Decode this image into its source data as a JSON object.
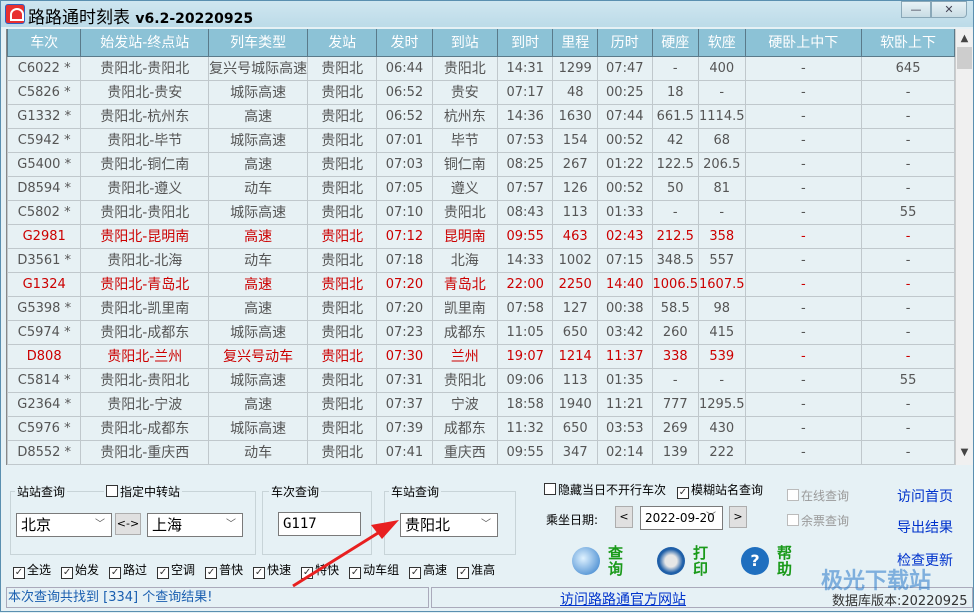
{
  "window": {
    "title": "路路通时刻表",
    "version": "v6.2-20220925",
    "minimize_glyph": "—",
    "close_glyph": "✕"
  },
  "table": {
    "columns": [
      "车次",
      "始发站-终点站",
      "列车类型",
      "发站",
      "发时",
      "到站",
      "到时",
      "里程",
      "历时",
      "硬座",
      "软座",
      "硬卧上中下",
      "软卧上下"
    ],
    "rows": [
      {
        "highlight": false,
        "cells": [
          "C6022 *",
          "贵阳北-贵阳北",
          "复兴号城际高速",
          "贵阳北",
          "06:44",
          "贵阳北",
          "14:31",
          "1299",
          "07:47",
          "-",
          "400",
          "-",
          "645"
        ]
      },
      {
        "highlight": false,
        "cells": [
          "C5826 *",
          "贵阳北-贵安",
          "城际高速",
          "贵阳北",
          "06:52",
          "贵安",
          "07:17",
          "48",
          "00:25",
          "18",
          "-",
          "-",
          "-"
        ]
      },
      {
        "highlight": false,
        "cells": [
          "G1332 *",
          "贵阳北-杭州东",
          "高速",
          "贵阳北",
          "06:52",
          "杭州东",
          "14:36",
          "1630",
          "07:44",
          "661.5",
          "1114.5",
          "-",
          "-"
        ]
      },
      {
        "highlight": false,
        "cells": [
          "C5942 *",
          "贵阳北-毕节",
          "城际高速",
          "贵阳北",
          "07:01",
          "毕节",
          "07:53",
          "154",
          "00:52",
          "42",
          "68",
          "-",
          "-"
        ]
      },
      {
        "highlight": false,
        "cells": [
          "G5400 *",
          "贵阳北-铜仁南",
          "高速",
          "贵阳北",
          "07:03",
          "铜仁南",
          "08:25",
          "267",
          "01:22",
          "122.5",
          "206.5",
          "-",
          "-"
        ]
      },
      {
        "highlight": false,
        "cells": [
          "D8594 *",
          "贵阳北-遵义",
          "动车",
          "贵阳北",
          "07:05",
          "遵义",
          "07:57",
          "126",
          "00:52",
          "50",
          "81",
          "-",
          "-"
        ]
      },
      {
        "highlight": false,
        "cells": [
          "C5802 *",
          "贵阳北-贵阳北",
          "城际高速",
          "贵阳北",
          "07:10",
          "贵阳北",
          "08:43",
          "113",
          "01:33",
          "-",
          "-",
          "-",
          "55"
        ]
      },
      {
        "highlight": true,
        "cells": [
          "G2981",
          "贵阳北-昆明南",
          "高速",
          "贵阳北",
          "07:12",
          "昆明南",
          "09:55",
          "463",
          "02:43",
          "212.5",
          "358",
          "-",
          "-"
        ]
      },
      {
        "highlight": false,
        "cells": [
          "D3561 *",
          "贵阳北-北海",
          "动车",
          "贵阳北",
          "07:18",
          "北海",
          "14:33",
          "1002",
          "07:15",
          "348.5",
          "557",
          "-",
          "-"
        ]
      },
      {
        "highlight": true,
        "cells": [
          "G1324",
          "贵阳北-青岛北",
          "高速",
          "贵阳北",
          "07:20",
          "青岛北",
          "22:00",
          "2250",
          "14:40",
          "1006.5",
          "1607.5",
          "-",
          "-"
        ]
      },
      {
        "highlight": false,
        "cells": [
          "G5398 *",
          "贵阳北-凯里南",
          "高速",
          "贵阳北",
          "07:20",
          "凯里南",
          "07:58",
          "127",
          "00:38",
          "58.5",
          "98",
          "-",
          "-"
        ]
      },
      {
        "highlight": false,
        "cells": [
          "C5974 *",
          "贵阳北-成都东",
          "城际高速",
          "贵阳北",
          "07:23",
          "成都东",
          "11:05",
          "650",
          "03:42",
          "260",
          "415",
          "-",
          "-"
        ]
      },
      {
        "highlight": true,
        "cells": [
          "D808",
          "贵阳北-兰州",
          "复兴号动车",
          "贵阳北",
          "07:30",
          "兰州",
          "19:07",
          "1214",
          "11:37",
          "338",
          "539",
          "-",
          "-"
        ]
      },
      {
        "highlight": false,
        "cells": [
          "C5814 *",
          "贵阳北-贵阳北",
          "城际高速",
          "贵阳北",
          "07:31",
          "贵阳北",
          "09:06",
          "113",
          "01:35",
          "-",
          "-",
          "-",
          "55"
        ]
      },
      {
        "highlight": false,
        "cells": [
          "G2364 *",
          "贵阳北-宁波",
          "高速",
          "贵阳北",
          "07:37",
          "宁波",
          "18:58",
          "1940",
          "11:21",
          "777",
          "1295.5",
          "-",
          "-"
        ]
      },
      {
        "highlight": false,
        "cells": [
          "C5976 *",
          "贵阳北-成都东",
          "城际高速",
          "贵阳北",
          "07:39",
          "成都东",
          "11:32",
          "650",
          "03:53",
          "269",
          "430",
          "-",
          "-"
        ]
      },
      {
        "highlight": false,
        "cells": [
          "D8552 *",
          "贵阳北-重庆西",
          "动车",
          "贵阳北",
          "07:41",
          "重庆西",
          "09:55",
          "347",
          "02:14",
          "139",
          "222",
          "-",
          "-"
        ]
      }
    ],
    "highlight_color": "#cc0000"
  },
  "station_query": {
    "label": "站站查询",
    "transfer_label": "指定中转站",
    "transfer_checked": false,
    "from": "北京",
    "to": "上海",
    "swap_label": "<->"
  },
  "train_query": {
    "label": "车次查询",
    "value": "G117"
  },
  "stop_query": {
    "label": "车站查询",
    "value": "贵阳北"
  },
  "options": {
    "hide_not_running": "隐藏当日不开行车次",
    "hide_not_running_checked": false,
    "fuzzy_search": "模糊站名查询",
    "fuzzy_search_checked": true,
    "online_query": "在线查询",
    "ticket_query": "余票查询",
    "date_label": "乘坐日期:",
    "date_value": "2022-09-20",
    "prev_label": "<",
    "next_label": ">"
  },
  "filters": [
    {
      "label": "全选",
      "checked": true
    },
    {
      "label": "始发",
      "checked": true
    },
    {
      "label": "路过",
      "checked": true
    },
    {
      "label": "空调",
      "checked": true
    },
    {
      "label": "普快",
      "checked": true
    },
    {
      "label": "快速",
      "checked": true
    },
    {
      "label": "特快",
      "checked": true
    },
    {
      "label": "动车组",
      "checked": true
    },
    {
      "label": "高速",
      "checked": true
    },
    {
      "label": "准高",
      "checked": true
    }
  ],
  "actions": {
    "search": "查询",
    "print": "打印",
    "help": "帮助"
  },
  "links": {
    "homepage": "访问首页",
    "export": "导出结果",
    "check_update": "检查更新",
    "official_site": "访问路路通官方网站"
  },
  "status": {
    "result_text": "本次查询共找到 [334] 个查询结果!",
    "db_version": "数据库版本:20220925"
  },
  "watermark": "极光下载站"
}
